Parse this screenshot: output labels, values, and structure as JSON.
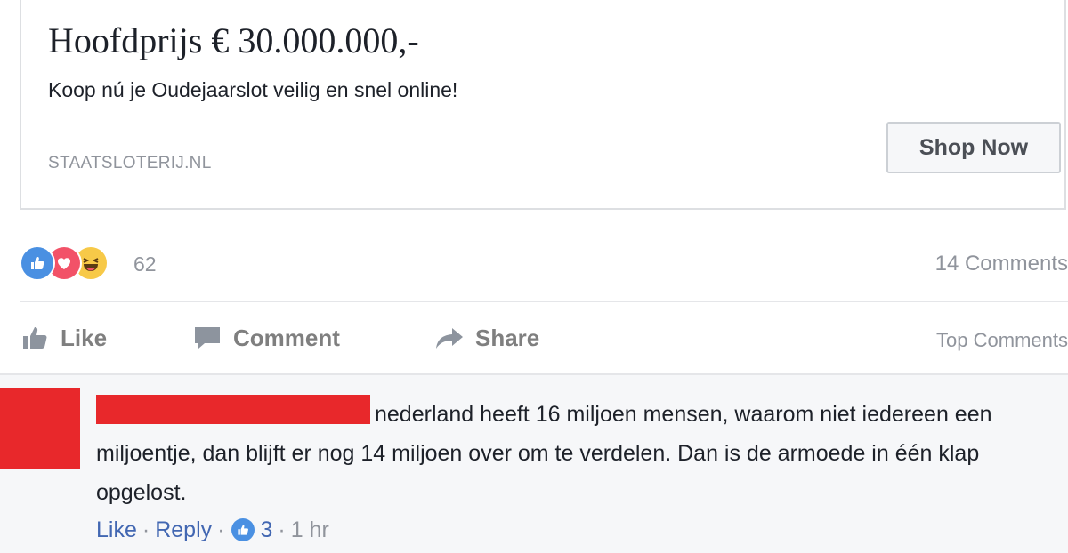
{
  "ad": {
    "title": "Hoofdprijs € 30.000.000,-",
    "description": "Koop nú je Oudejaarslot veilig en snel online!",
    "domain": "STAATSLOTERIJ.NL",
    "cta_label": "Shop Now"
  },
  "reactions": {
    "types": [
      "like",
      "love",
      "haha"
    ],
    "count": "62",
    "comments_count": "14 Comments"
  },
  "actions": {
    "like_label": "Like",
    "comment_label": "Comment",
    "share_label": "Share",
    "sort_label": "Top Comments"
  },
  "comment": {
    "text": "nederland heeft 16 miljoen mensen, waarom niet iedereen een miljoentje, dan blijft er nog 14 miljoen over om te verdelen. Dan is de armoede in één klap opgelost.",
    "like_label": "Like",
    "reply_label": "Reply",
    "separator": "·",
    "like_count": "3",
    "time": "1 hr"
  },
  "colors": {
    "redaction": "#e8282b",
    "link": "#4267b2",
    "muted": "#90949c",
    "like_blue": "#4a90e2",
    "love_red": "#f25268",
    "haha_yellow": "#f7c948"
  }
}
